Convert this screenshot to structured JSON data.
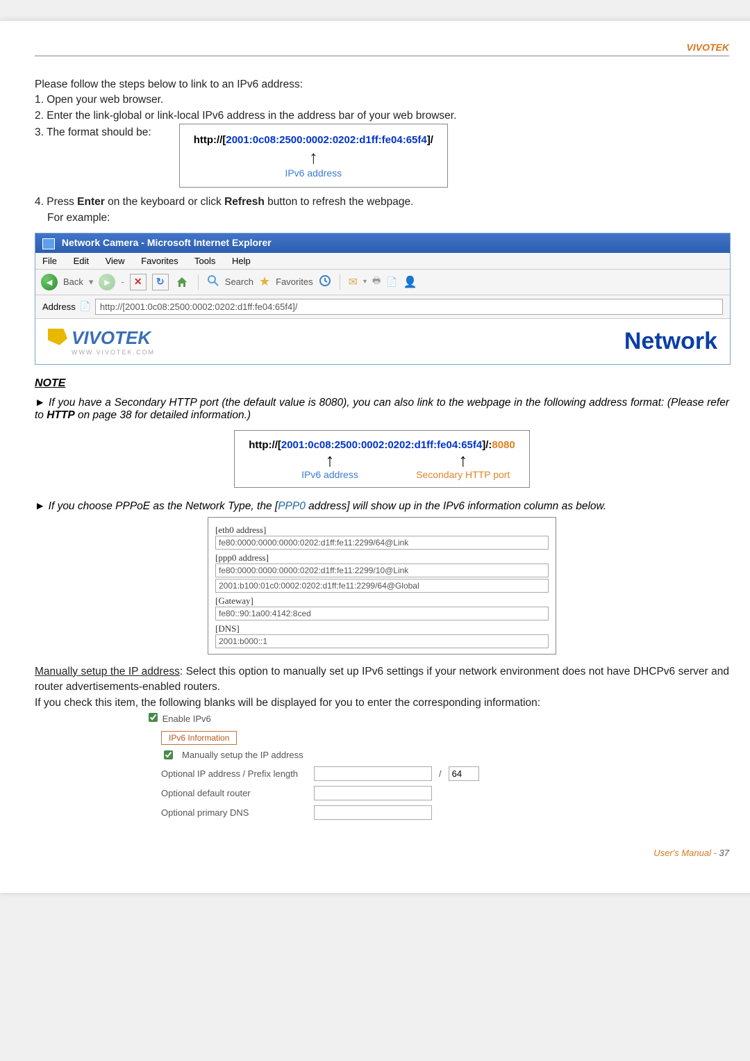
{
  "header": {
    "brand": "VIVOTEK"
  },
  "intro": {
    "lead": "Please follow the steps below to link to an IPv6 address:",
    "step1": "1. Open your web browser.",
    "step2": "2. Enter the link-global or link-local IPv6 address in the address bar of your web browser.",
    "step3": "3. The format should be:"
  },
  "url1": {
    "prefix": "http://[",
    "addr": "2001:0c08:2500:0002:0202:d1ff:fe04:65f4",
    "suffix": "]/",
    "label": "IPv6 address"
  },
  "step4": {
    "a": "4. Press ",
    "enter": "Enter",
    "b": " on the keyboard or click ",
    "refresh": "Refresh",
    "c": " button to refresh the webpage.",
    "eg": "For example:"
  },
  "ie": {
    "title": "Network Camera - Microsoft Internet Explorer",
    "menu": {
      "file": "File",
      "edit": "Edit",
      "view": "View",
      "fav": "Favorites",
      "tools": "Tools",
      "help": "Help"
    },
    "toolbar": {
      "back": "Back",
      "search": "Search",
      "favorites": "Favorites"
    },
    "addrlabel": "Address",
    "addrval": "http://[2001:0c08:2500:0002:0202:d1ff:fe04:65f4]/",
    "logo": "VIVOTEK",
    "logosub": "WWW.VIVOTEK.COM",
    "network": "Network "
  },
  "note": {
    "title": "NOTE",
    "n1a": "► If you have a Secondary HTTP port (the default value is 8080), you can also link to the webpage in the following address format: (Please refer to ",
    "n1b": "HTTP",
    "n1c": " on page 38 for detailed information.)"
  },
  "url2": {
    "prefix": "http://[",
    "addr": "2001:0c08:2500:0002:0202:d1ff:fe04:65f4",
    "mid": "]/:",
    "port": "8080",
    "label1": "IPv6 address",
    "label2": "Secondary HTTP port"
  },
  "note2": {
    "a": "► If you choose PPPoE as the Network Type, the [",
    "ppp": "PPP0",
    "b": " address] will show up in the IPv6 information column as below."
  },
  "ipv6box": {
    "eth0": "[eth0 address]",
    "eth0v": "fe80:0000:0000:0000:0202:d1ff:fe11:2299/64@Link",
    "ppp0": "[ppp0 address]",
    "ppp0v1": "fe80:0000:0000:0000:0202:d1ff:fe11:2299/10@Link",
    "ppp0v2": "2001:b100:01c0:0002:0202:d1ff:fe11:2299/64@Global",
    "gw": "[Gateway]",
    "gwv": "fe80::90:1a00:4142:8ced",
    "dns": "[DNS]",
    "dnsv": "2001:b000::1"
  },
  "manual": {
    "lead_u": "Manually setup the IP address",
    "lead_rest": ": Select this option to manually set up IPv6 settings if your network environment does not have DHCPv6 server and router advertisements-enabled routers.",
    "line2": "If you check this item, the following blanks will be displayed for you to enter the corresponding information:"
  },
  "settings": {
    "enable": "Enable IPv6",
    "info_btn": "IPv6 Information",
    "manual_cb": "Manually setup the IP address",
    "opt_ip": "Optional IP address / Prefix length",
    "prefix": "64",
    "sep": "/",
    "opt_router": "Optional default router",
    "opt_dns": "Optional primary DNS"
  },
  "footer": {
    "label": "User's Manual - ",
    "page": "37"
  }
}
